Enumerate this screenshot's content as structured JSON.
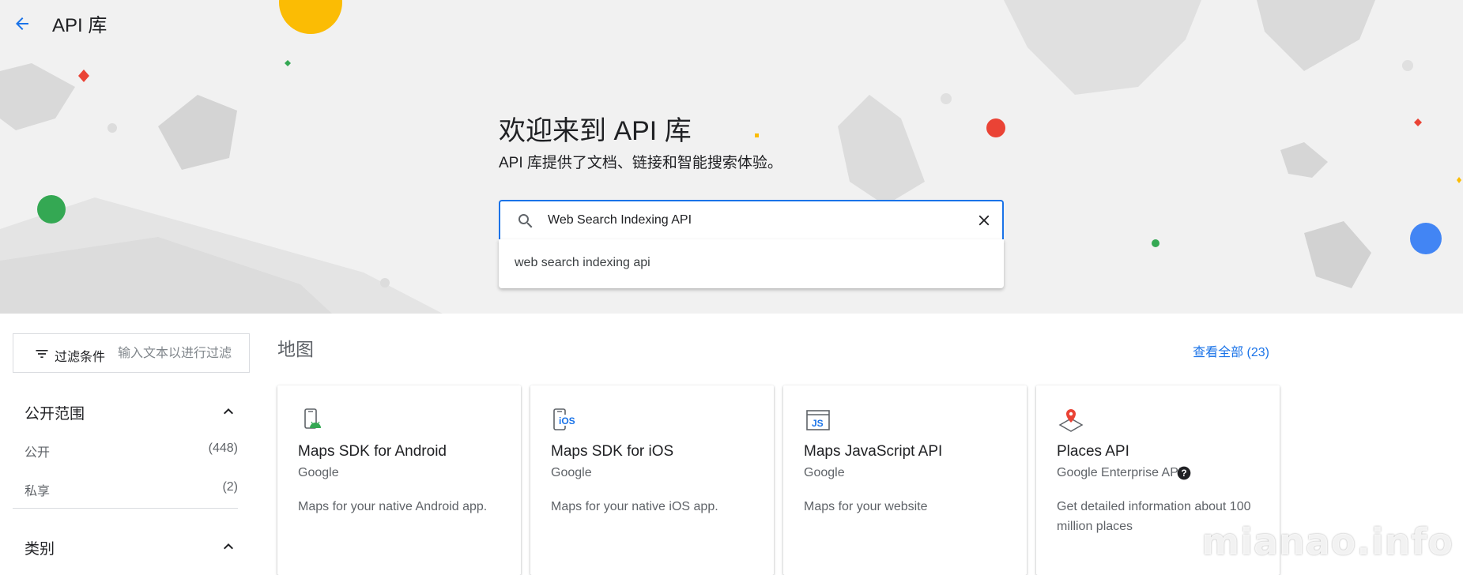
{
  "header": {
    "title": "API 库"
  },
  "hero": {
    "heading": "欢迎来到 API 库",
    "subheading": "API 库提供了文档、链接和智能搜索体验。",
    "search_value": "Web Search Indexing API",
    "suggestions": [
      "web search indexing api"
    ]
  },
  "sidebar": {
    "filter_label": "过滤条件",
    "filter_placeholder": "输入文本以进行过滤",
    "sections": [
      {
        "title": "公开范围",
        "items": [
          {
            "label": "公开",
            "count": "(448)"
          },
          {
            "label": "私享",
            "count": "(2)"
          }
        ]
      },
      {
        "title": "类别",
        "items": []
      }
    ]
  },
  "main": {
    "category_title": "地图",
    "view_all": "查看全部 (23)",
    "cards": [
      {
        "icon": "android-phone-icon",
        "title": "Maps SDK for Android",
        "vendor": "Google",
        "description": "Maps for your native Android app."
      },
      {
        "icon": "ios-phone-icon",
        "title": "Maps SDK for iOS",
        "vendor": "Google",
        "description": "Maps for your native iOS app."
      },
      {
        "icon": "javascript-window-icon",
        "title": "Maps JavaScript API",
        "vendor": "Google",
        "description": "Maps for your website"
      },
      {
        "icon": "map-pin-icon",
        "title": "Places API",
        "vendor": "Google Enterprise API",
        "description": "Get detailed information about 100 million places"
      }
    ]
  },
  "watermark": "mianao.info",
  "colors": {
    "accent": "#1a73e8",
    "hero_bg": "#f1f1f1",
    "text": "#202124",
    "muted": "#5f6368"
  }
}
